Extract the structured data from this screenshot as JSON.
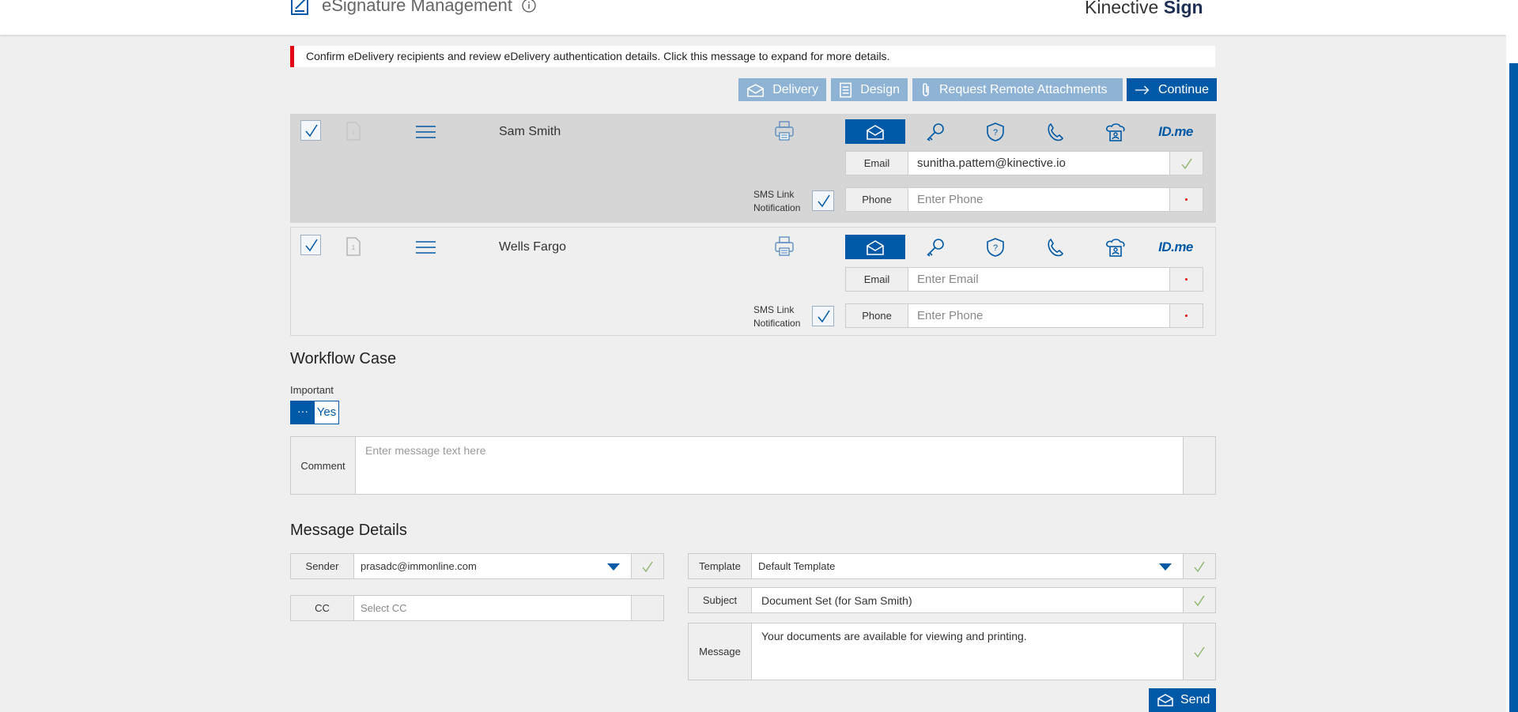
{
  "header": {
    "title": "eSignature Management",
    "brand_regular": "Kinective",
    "brand_bold": "Sign"
  },
  "alert": {
    "text": "Confirm eDelivery recipients and review eDelivery authentication details. Click this message to expand for more details."
  },
  "toolbar": {
    "delivery": "Delivery",
    "design": "Design",
    "request_remote": "Request Remote Attachments",
    "continue": "Continue"
  },
  "recipients": [
    {
      "name": "Sam Smith",
      "doc_number": "1",
      "email_label": "Email",
      "email_value": "sunitha.pattem@kinective.io",
      "phone_label": "Phone",
      "phone_placeholder": "Enter Phone",
      "sms_label_1": "SMS Link",
      "sms_label_2": "Notification",
      "idme": "ID",
      "idme_suffix": ".me"
    },
    {
      "name": "Wells Fargo",
      "doc_number": "1",
      "email_label": "Email",
      "email_placeholder": "Enter Email",
      "phone_label": "Phone",
      "phone_placeholder": "Enter Phone",
      "sms_label_1": "SMS Link",
      "sms_label_2": "Notification",
      "idme": "ID",
      "idme_suffix": ".me"
    }
  ],
  "workflow": {
    "title": "Workflow Case",
    "important_label": "Important",
    "toggle_off": "···",
    "toggle_on": "Yes",
    "comment_label": "Comment",
    "comment_placeholder": "Enter message text here"
  },
  "message_details": {
    "title": "Message Details",
    "sender_label": "Sender",
    "sender_value": "prasadc@immonline.com",
    "cc_label": "CC",
    "cc_placeholder": "Select CC",
    "template_label": "Template",
    "template_value": "Default Template",
    "subject_label": "Subject",
    "subject_value": "Document Set (for Sam Smith)",
    "message_label": "Message",
    "message_value": "Your documents are available for viewing and printing.",
    "send": "Send"
  },
  "colors": {
    "primary": "#0059a6",
    "primary_light": "#8fb3d4",
    "alert_red": "#e30613",
    "check_green": "#8ab46a"
  }
}
